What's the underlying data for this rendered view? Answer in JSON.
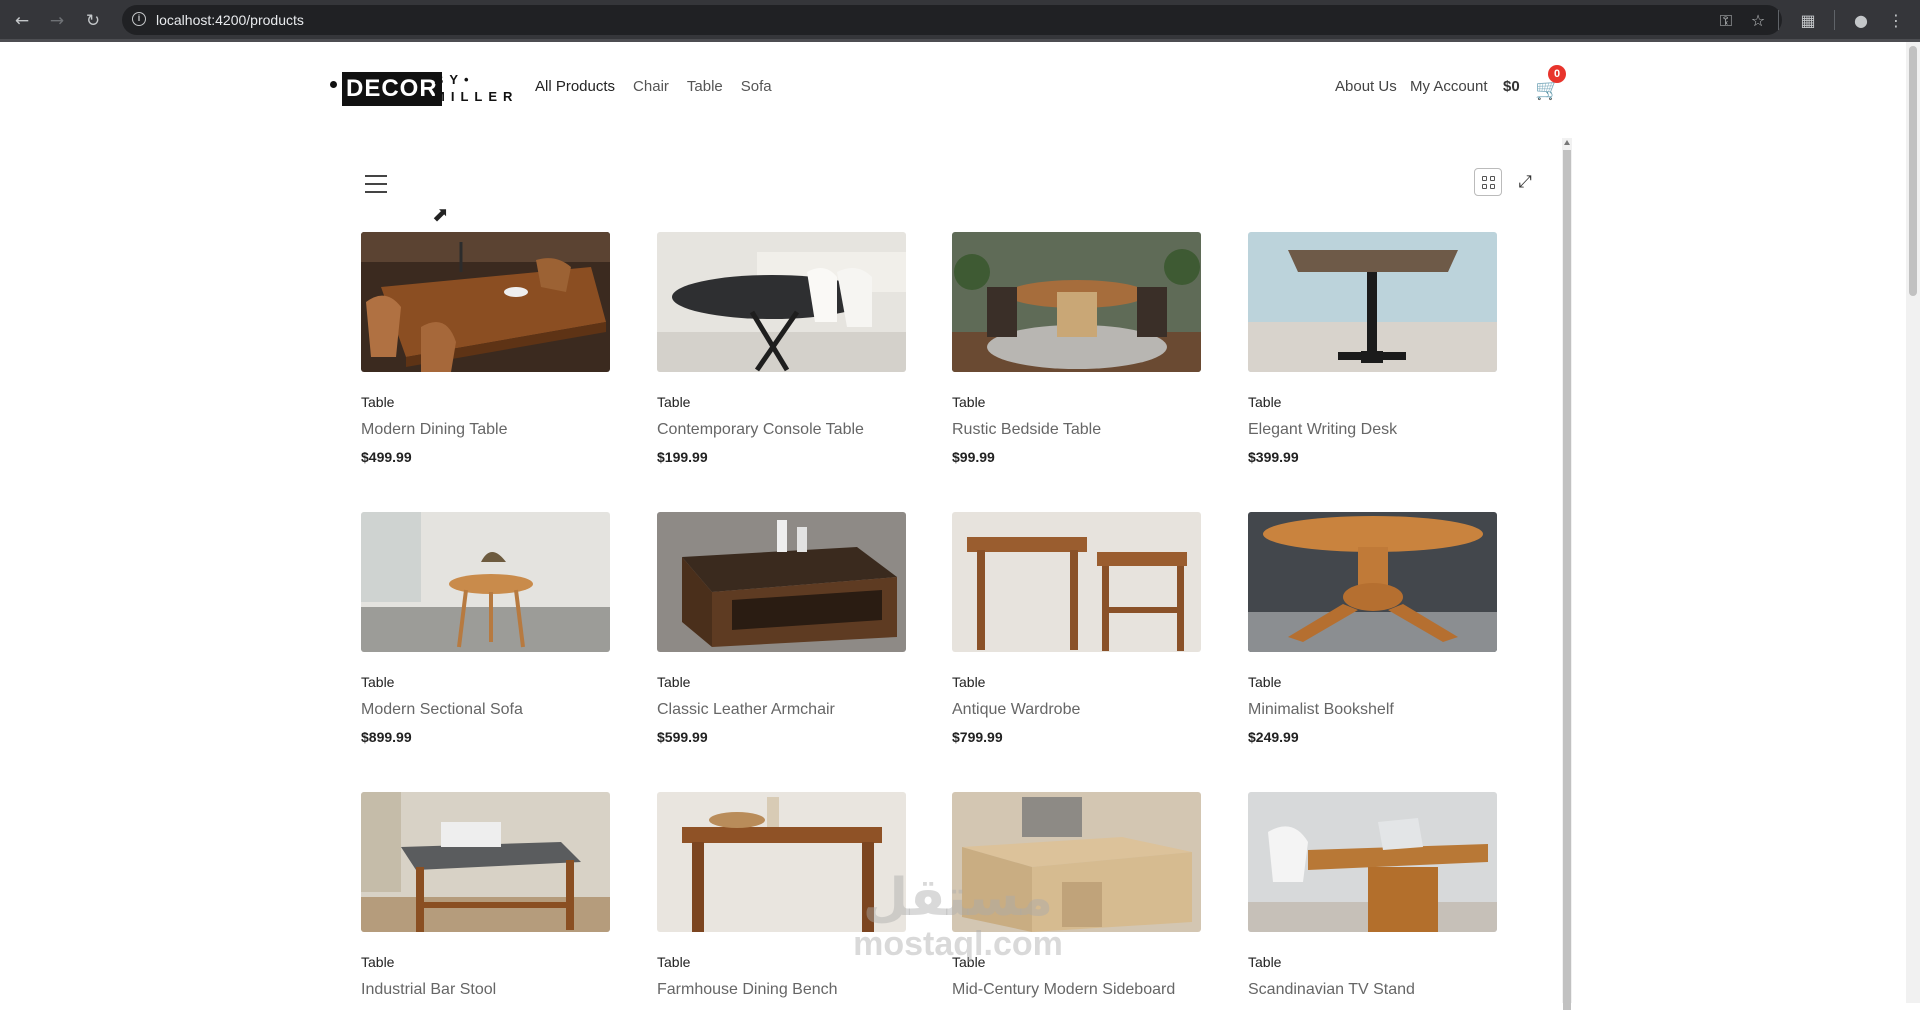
{
  "browser": {
    "url": "localhost:4200/products",
    "icons": [
      "back-icon",
      "forward-icon",
      "reload-icon",
      "site-info-icon",
      "key-icon",
      "star-icon",
      "extensions-icon",
      "profile-icon",
      "menu-dots-icon"
    ]
  },
  "header": {
    "logo": {
      "main": "DECOR",
      "by": "BY•",
      "maker": "MILLER"
    },
    "nav": [
      "All Products",
      "Chair",
      "Table",
      "Sofa"
    ],
    "about": "About Us",
    "account": "My Account",
    "cart_total": "$0",
    "cart_count": "0"
  },
  "products": [
    {
      "category": "Table",
      "name": "Modern Dining Table",
      "price": "$499.99"
    },
    {
      "category": "Table",
      "name": "Contemporary Console Table",
      "price": "$199.99"
    },
    {
      "category": "Table",
      "name": "Rustic Bedside Table",
      "price": "$99.99"
    },
    {
      "category": "Table",
      "name": "Elegant Writing Desk",
      "price": "$399.99"
    },
    {
      "category": "Table",
      "name": "Modern Sectional Sofa",
      "price": "$899.99"
    },
    {
      "category": "Table",
      "name": "Classic Leather Armchair",
      "price": "$599.99"
    },
    {
      "category": "Table",
      "name": "Antique Wardrobe",
      "price": "$799.99"
    },
    {
      "category": "Table",
      "name": "Minimalist Bookshelf",
      "price": "$249.99"
    },
    {
      "category": "Table",
      "name": "Industrial Bar Stool",
      "price": ""
    },
    {
      "category": "Table",
      "name": "Farmhouse Dining Bench",
      "price": ""
    },
    {
      "category": "Table",
      "name": "Mid-Century Modern Sideboard",
      "price": ""
    },
    {
      "category": "Table",
      "name": "Scandinavian TV Stand",
      "price": ""
    }
  ],
  "watermark": {
    "line1": "مستقل",
    "line2": "mostaql.com"
  },
  "colors": {
    "badge": "#e8342c",
    "chrome": "#35363a",
    "text": "#222222"
  }
}
